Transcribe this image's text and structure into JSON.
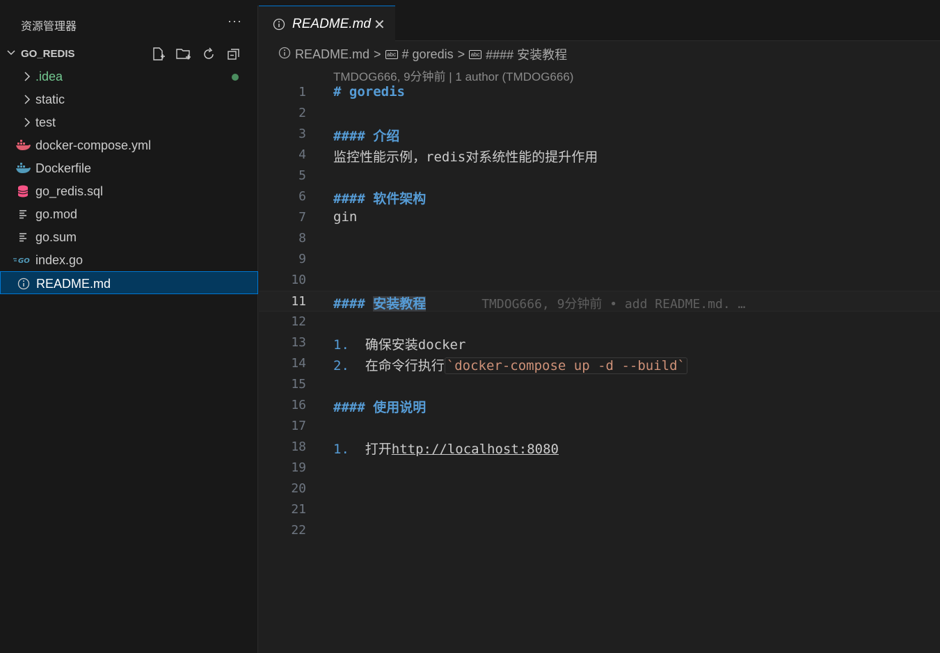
{
  "sidebar": {
    "title": "资源管理器",
    "more": "···",
    "folder": "GO_REDIS",
    "items": [
      {
        "label": ".idea",
        "icon": "chevron-right-icon",
        "modified": true
      },
      {
        "label": "static",
        "icon": "chevron-right-icon"
      },
      {
        "label": "test",
        "icon": "chevron-right-icon"
      },
      {
        "label": "docker-compose.yml",
        "icon": "docker-icon"
      },
      {
        "label": "Dockerfile",
        "icon": "docker-icon"
      },
      {
        "label": "go_redis.sql",
        "icon": "database-icon"
      },
      {
        "label": "go.mod",
        "icon": "lines-icon"
      },
      {
        "label": "go.sum",
        "icon": "lines-icon"
      },
      {
        "label": "index.go",
        "icon": "go-icon"
      },
      {
        "label": "README.md",
        "icon": "info-icon",
        "selected": true
      }
    ]
  },
  "tab": {
    "label": "README.md",
    "close": "✕"
  },
  "breadcrumb": {
    "file": "README.md",
    "sep": ">",
    "sym1": "# goredis",
    "sym2": "#### 安装教程",
    "box": "abc"
  },
  "blame": {
    "header": "TMDOG666, 9分钟前 | 1 author (TMDOG666)",
    "inline": "TMDOG666, 9分钟前 • add README.md. …"
  },
  "lines": {
    "n1": "1",
    "n2": "2",
    "n3": "3",
    "n4": "4",
    "n5": "5",
    "n6": "6",
    "n7": "7",
    "n8": "8",
    "n9": "9",
    "n10": "10",
    "n11": "11",
    "n12": "12",
    "n13": "13",
    "n14": "14",
    "n15": "15",
    "n16": "16",
    "n17": "17",
    "n18": "18",
    "n19": "19",
    "n20": "20",
    "n21": "21",
    "n22": "22",
    "l1": "# goredis",
    "l3": "#### 介绍",
    "l4a": "监控性能示例，",
    "l4b": "redis",
    "l4c": "对系统性能的提升作用",
    "l6": "#### 软件架构",
    "l7": "gin",
    "l11a": "#### ",
    "l11b": "安装教程",
    "l13a": "1.",
    "l13b": "  确保安装",
    "l13c": "docker",
    "l14a": "2.",
    "l14b": "  在命令行执行",
    "l14c": "`docker-compose up -d --build`",
    "l16": "#### 使用说明",
    "l18a": "1.",
    "l18b": "  打开",
    "l18c": "http://localhost:8080"
  }
}
